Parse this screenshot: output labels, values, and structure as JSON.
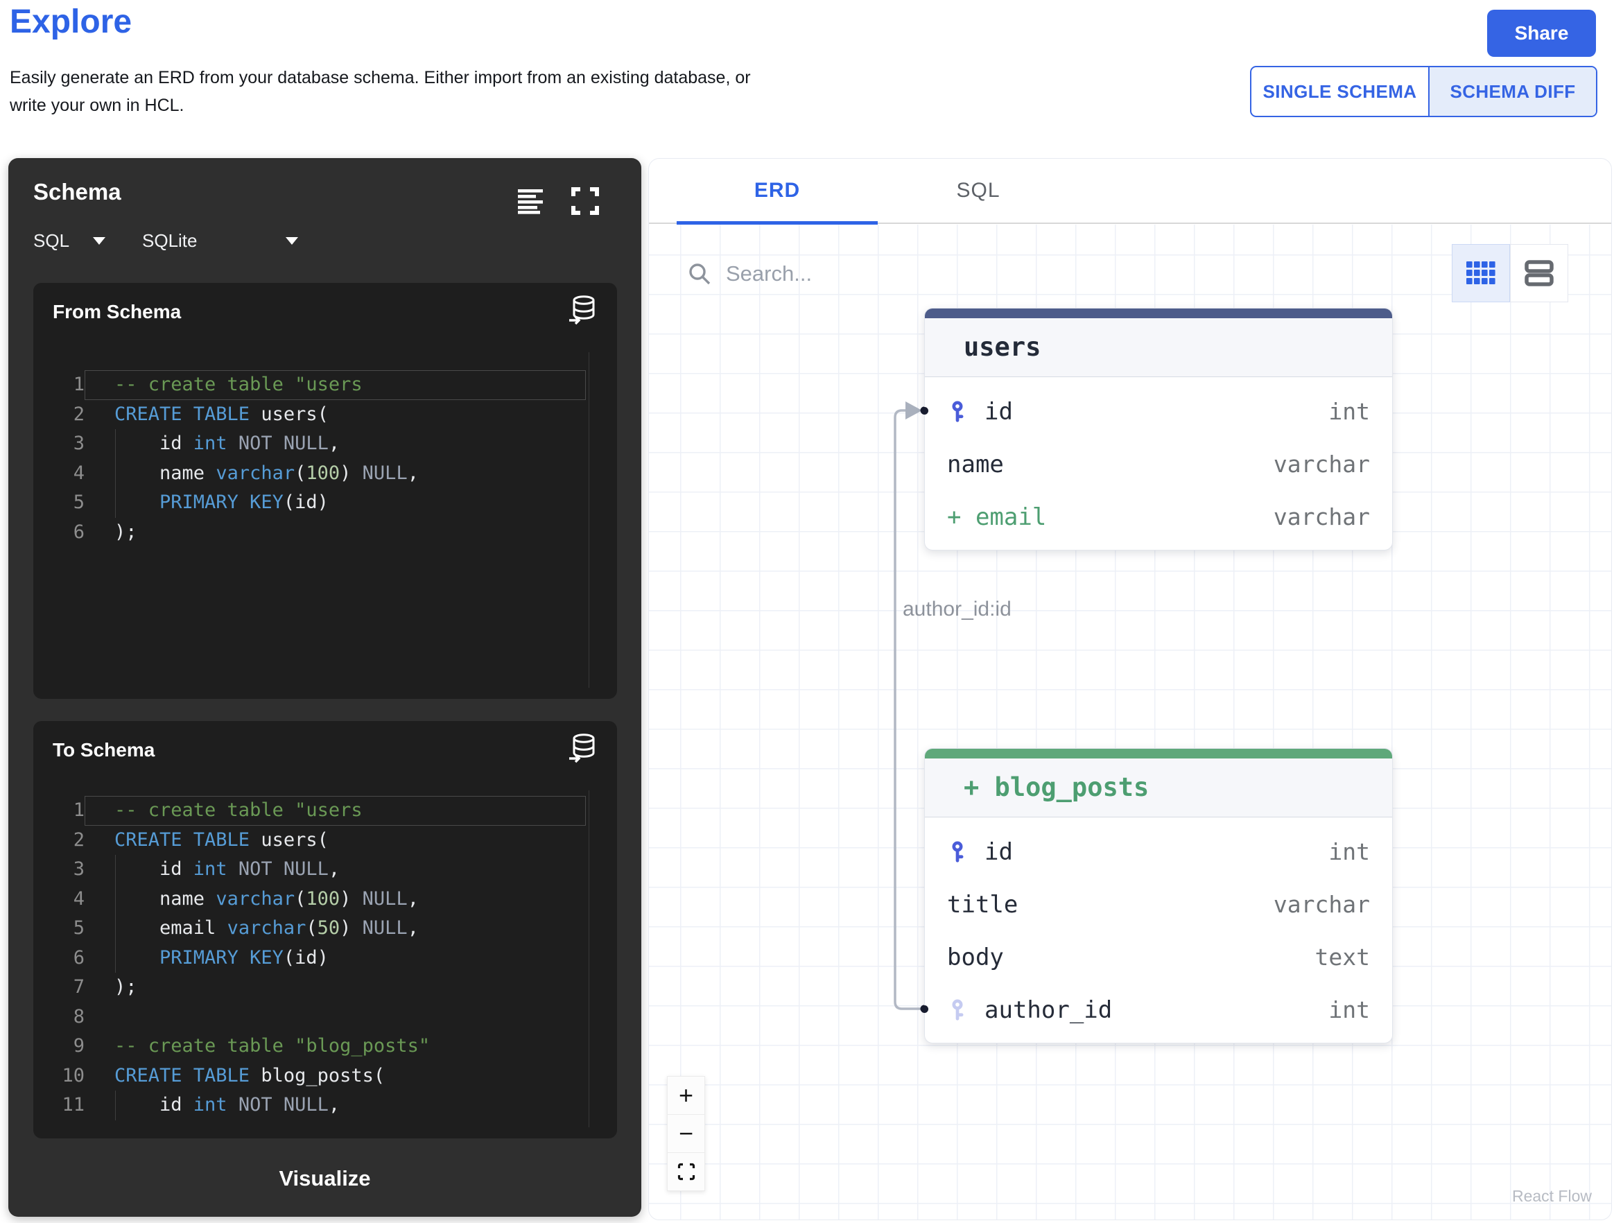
{
  "header": {
    "title": "Explore",
    "description_line1": "Easily generate an ERD from your database schema. Either import from an existing database, or",
    "description_line2": "write your own in HCL.",
    "share_label": "Share",
    "mode_toggle": {
      "options": [
        "SINGLE SCHEMA",
        "SCHEMA DIFF"
      ],
      "selected": "SCHEMA DIFF"
    }
  },
  "schema_panel": {
    "title": "Schema",
    "dialect": "SQL",
    "engine": "SQLite",
    "from_schema": {
      "title": "From Schema",
      "lines": [
        {
          "n": 1,
          "active": true,
          "tokens": [
            [
              "cm",
              "-- create table \"users"
            ]
          ]
        },
        {
          "n": 2,
          "tokens": [
            [
              "kw",
              "CREATE TABLE"
            ],
            [
              "tx",
              " users("
            ]
          ]
        },
        {
          "n": 3,
          "guide": true,
          "tokens": [
            [
              "tx",
              "    id "
            ],
            [
              "kw",
              "int"
            ],
            [
              "nl",
              " NOT NULL"
            ],
            [
              "tx",
              ","
            ]
          ]
        },
        {
          "n": 4,
          "guide": true,
          "tokens": [
            [
              "tx",
              "    name "
            ],
            [
              "kw",
              "varchar"
            ],
            [
              "tx",
              "("
            ],
            [
              "num",
              "100"
            ],
            [
              "tx",
              ") "
            ],
            [
              "nl",
              "NULL"
            ],
            [
              "tx",
              ","
            ]
          ]
        },
        {
          "n": 5,
          "guide": true,
          "tokens": [
            [
              "tx",
              "    "
            ],
            [
              "kw",
              "PRIMARY KEY"
            ],
            [
              "tx",
              "(id)"
            ]
          ]
        },
        {
          "n": 6,
          "tokens": [
            [
              "tx",
              ");"
            ]
          ]
        }
      ]
    },
    "to_schema": {
      "title": "To Schema",
      "lines": [
        {
          "n": 1,
          "active": true,
          "tokens": [
            [
              "cm",
              "-- create table \"users"
            ]
          ]
        },
        {
          "n": 2,
          "tokens": [
            [
              "kw",
              "CREATE TABLE"
            ],
            [
              "tx",
              " users("
            ]
          ]
        },
        {
          "n": 3,
          "guide": true,
          "tokens": [
            [
              "tx",
              "    id "
            ],
            [
              "kw",
              "int"
            ],
            [
              "nl",
              " NOT NULL"
            ],
            [
              "tx",
              ","
            ]
          ]
        },
        {
          "n": 4,
          "guide": true,
          "tokens": [
            [
              "tx",
              "    name "
            ],
            [
              "kw",
              "varchar"
            ],
            [
              "tx",
              "("
            ],
            [
              "num",
              "100"
            ],
            [
              "tx",
              ") "
            ],
            [
              "nl",
              "NULL"
            ],
            [
              "tx",
              ","
            ]
          ]
        },
        {
          "n": 5,
          "guide": true,
          "tokens": [
            [
              "tx",
              "    email "
            ],
            [
              "kw",
              "varchar"
            ],
            [
              "tx",
              "("
            ],
            [
              "num",
              "50"
            ],
            [
              "tx",
              ") "
            ],
            [
              "nl",
              "NULL"
            ],
            [
              "tx",
              ","
            ]
          ]
        },
        {
          "n": 6,
          "guide": true,
          "tokens": [
            [
              "tx",
              "    "
            ],
            [
              "kw",
              "PRIMARY KEY"
            ],
            [
              "tx",
              "(id)"
            ]
          ]
        },
        {
          "n": 7,
          "tokens": [
            [
              "tx",
              ");"
            ]
          ]
        },
        {
          "n": 8,
          "tokens": []
        },
        {
          "n": 9,
          "tokens": [
            [
              "cm",
              "-- create table \"blog_posts\""
            ]
          ]
        },
        {
          "n": 10,
          "tokens": [
            [
              "kw",
              "CREATE TABLE"
            ],
            [
              "tx",
              " blog_posts("
            ]
          ]
        },
        {
          "n": 11,
          "guide": true,
          "tokens": [
            [
              "tx",
              "    id "
            ],
            [
              "kw",
              "int"
            ],
            [
              "nl",
              " NOT NULL"
            ],
            [
              "tx",
              ","
            ]
          ]
        }
      ]
    },
    "visualize_label": "Visualize"
  },
  "erd_panel": {
    "tabs": [
      "ERD",
      "SQL"
    ],
    "active_tab": "ERD",
    "search_placeholder": "Search...",
    "edge_label": "author_id:id",
    "attribution": "React Flow",
    "controls": {
      "zoom_in": "+",
      "zoom_out": "−"
    },
    "tables": [
      {
        "title": "users",
        "title_color": "#242b39",
        "accent_color": "#4d5c8a",
        "columns": [
          {
            "name": "id",
            "type": "int",
            "key": "pk"
          },
          {
            "name": "name",
            "type": "varchar"
          },
          {
            "name": "+ email",
            "type": "varchar",
            "added": true
          }
        ]
      },
      {
        "title": "+ blog_posts",
        "title_color": "#4d9e71",
        "accent_color": "#5fa87a",
        "columns": [
          {
            "name": "id",
            "type": "int",
            "key": "pk"
          },
          {
            "name": "title",
            "type": "varchar"
          },
          {
            "name": "body",
            "type": "text"
          },
          {
            "name": "author_id",
            "type": "int",
            "key": "fk"
          }
        ]
      }
    ]
  },
  "colors": {
    "brand_blue": "#2e63e6",
    "share_blue": "#3564e4",
    "added_green": "#4d9e71",
    "pk_key": "#4a5cd9",
    "fk_key": "#c5cbf1",
    "edge_gray": "#b2b8c4",
    "users_accent": "#4d5c8a",
    "blog_accent": "#5fa87a",
    "code_comment": "#6a9955",
    "code_keyword": "#569cd6",
    "code_number": "#b5cea8"
  }
}
